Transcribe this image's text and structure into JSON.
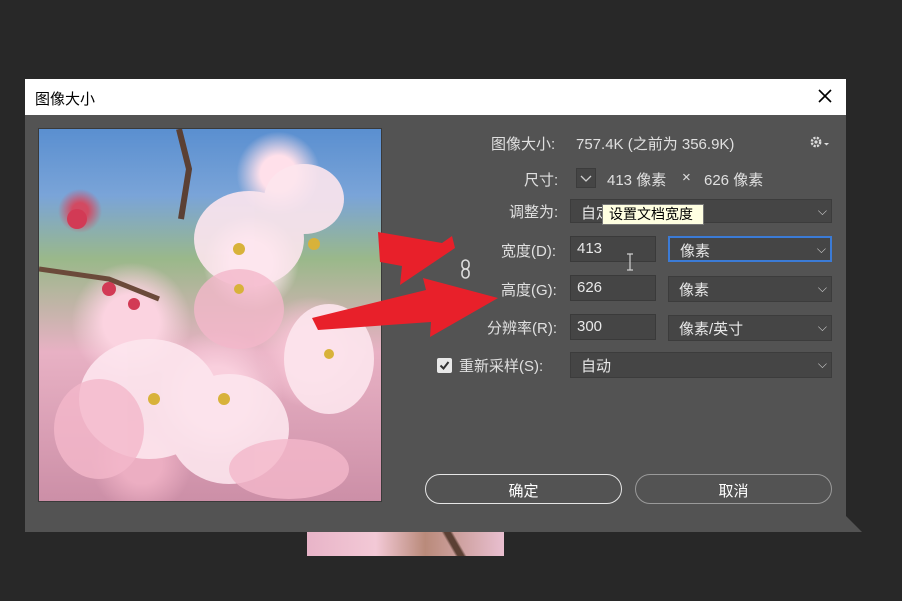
{
  "dialog": {
    "title": "图像大小"
  },
  "info": {
    "image_size_label": "图像大小:",
    "image_size_value": "757.4K (之前为 356.9K)",
    "dimensions_label": "尺寸:",
    "dim_width": "413 像素",
    "dim_times": "×",
    "dim_height": "626 像素"
  },
  "fit_to": {
    "label": "调整为:",
    "value": "自定"
  },
  "width": {
    "label": "宽度(D):",
    "value": "413",
    "unit": "像素"
  },
  "height": {
    "label": "高度(G):",
    "value": "626",
    "unit": "像素"
  },
  "resolution": {
    "label": "分辨率(R):",
    "value": "300",
    "unit": "像素/英寸"
  },
  "resample": {
    "label": "重新采样(S):",
    "checked": true,
    "value": "自动"
  },
  "tooltip": "设置文档宽度",
  "buttons": {
    "ok": "确定",
    "cancel": "取消"
  },
  "colors": {
    "dialog_bg": "#535353",
    "focus_border": "#3b7bd6",
    "arrow_red": "#e8202a"
  }
}
